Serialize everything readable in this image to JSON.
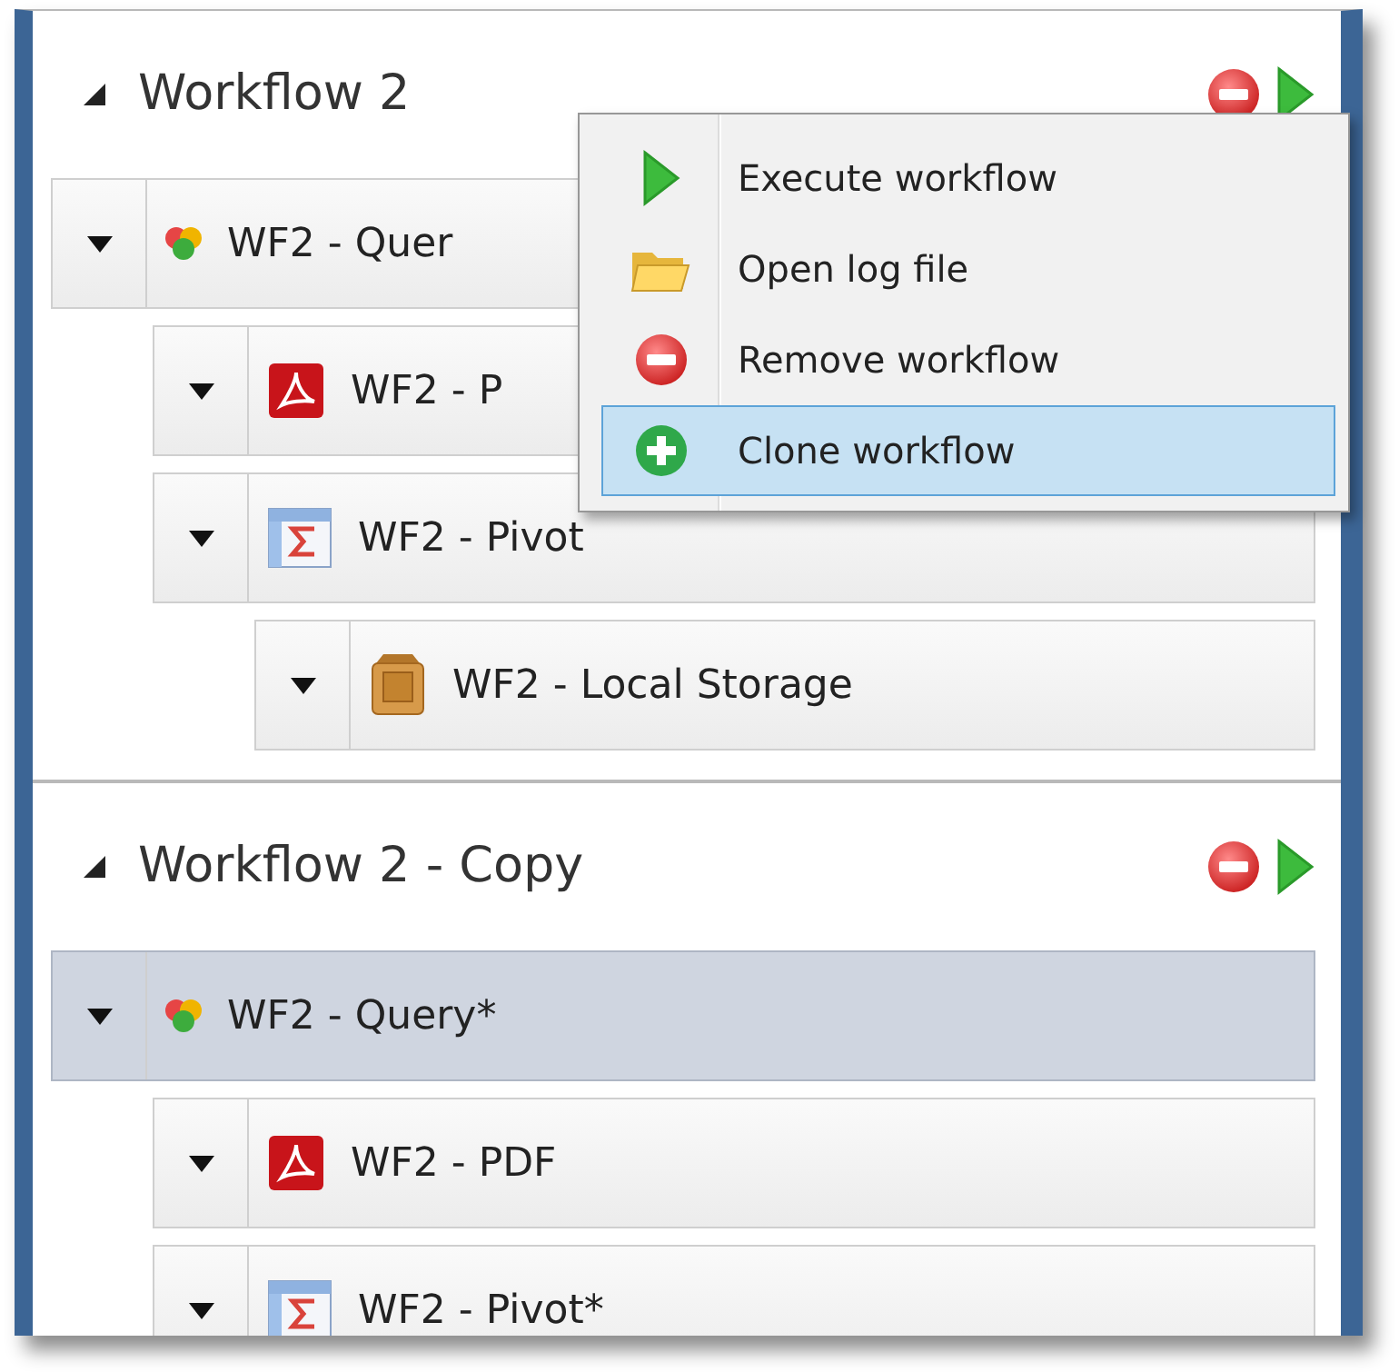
{
  "workflows": [
    {
      "title": "Workflow 2",
      "expanded": true,
      "nodes": [
        {
          "kind": "sql",
          "label": "WF2 - Quer",
          "selected": false,
          "children": [
            {
              "kind": "pdf",
              "label": "WF2 - P",
              "selected": false
            },
            {
              "kind": "pivot",
              "label": "WF2 - Pivot",
              "selected": false,
              "children": [
                {
                  "kind": "storage",
                  "label": "WF2 - Local Storage",
                  "selected": false
                }
              ]
            }
          ]
        }
      ]
    },
    {
      "title": "Workflow 2 - Copy",
      "expanded": true,
      "nodes": [
        {
          "kind": "sql",
          "label": "WF2 - Query*",
          "selected": true,
          "children": [
            {
              "kind": "pdf",
              "label": "WF2 - PDF",
              "selected": false
            },
            {
              "kind": "pivot",
              "label": "WF2 - Pivot*",
              "selected": false
            }
          ]
        }
      ]
    }
  ],
  "context_menu": [
    {
      "kind": "execute",
      "label": "Execute workflow",
      "selected": false
    },
    {
      "kind": "open",
      "label": "Open log file",
      "selected": false
    },
    {
      "kind": "remove",
      "label": "Remove workflow",
      "selected": false
    },
    {
      "kind": "clone",
      "label": "Clone workflow",
      "selected": true
    }
  ]
}
